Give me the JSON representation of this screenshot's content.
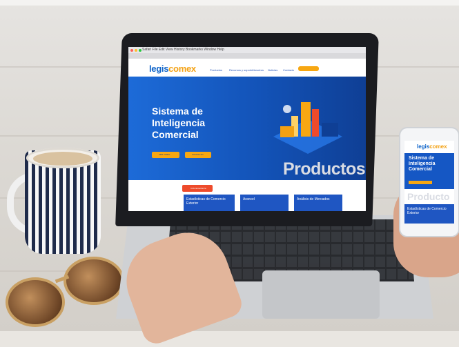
{
  "os_menu": "   Safari   File   Edit   View   History   Bookmarks   Window   Help",
  "site": {
    "logo_legis": "legis",
    "logo_comex": "comex",
    "nav": [
      "Productos",
      "Recursos y soporte",
      "Nosotros",
      "Noticias",
      "Contacto"
    ],
    "hero_title": "Sistema de Inteligencia Comercial",
    "hero_buttons": [
      "VER VIDEO",
      "CONTACTO"
    ],
    "products_heading": "Productos",
    "cta": "Ciclo Enseñanza",
    "cards": [
      "Estadísticas de Comercio Exterior",
      "Arancel",
      "Análisis de Mercados"
    ]
  },
  "phone": {
    "logo_legis": "legis",
    "logo_comex": "comex",
    "hero_title": "Sistema de Inteligencia Comercial",
    "products_heading": "Producto",
    "card": "Estadísticas de Comercio Exterior"
  },
  "colors": {
    "brand_blue": "#1557c4",
    "brand_orange": "#f7a712",
    "cta_red": "#ee4b2b"
  }
}
